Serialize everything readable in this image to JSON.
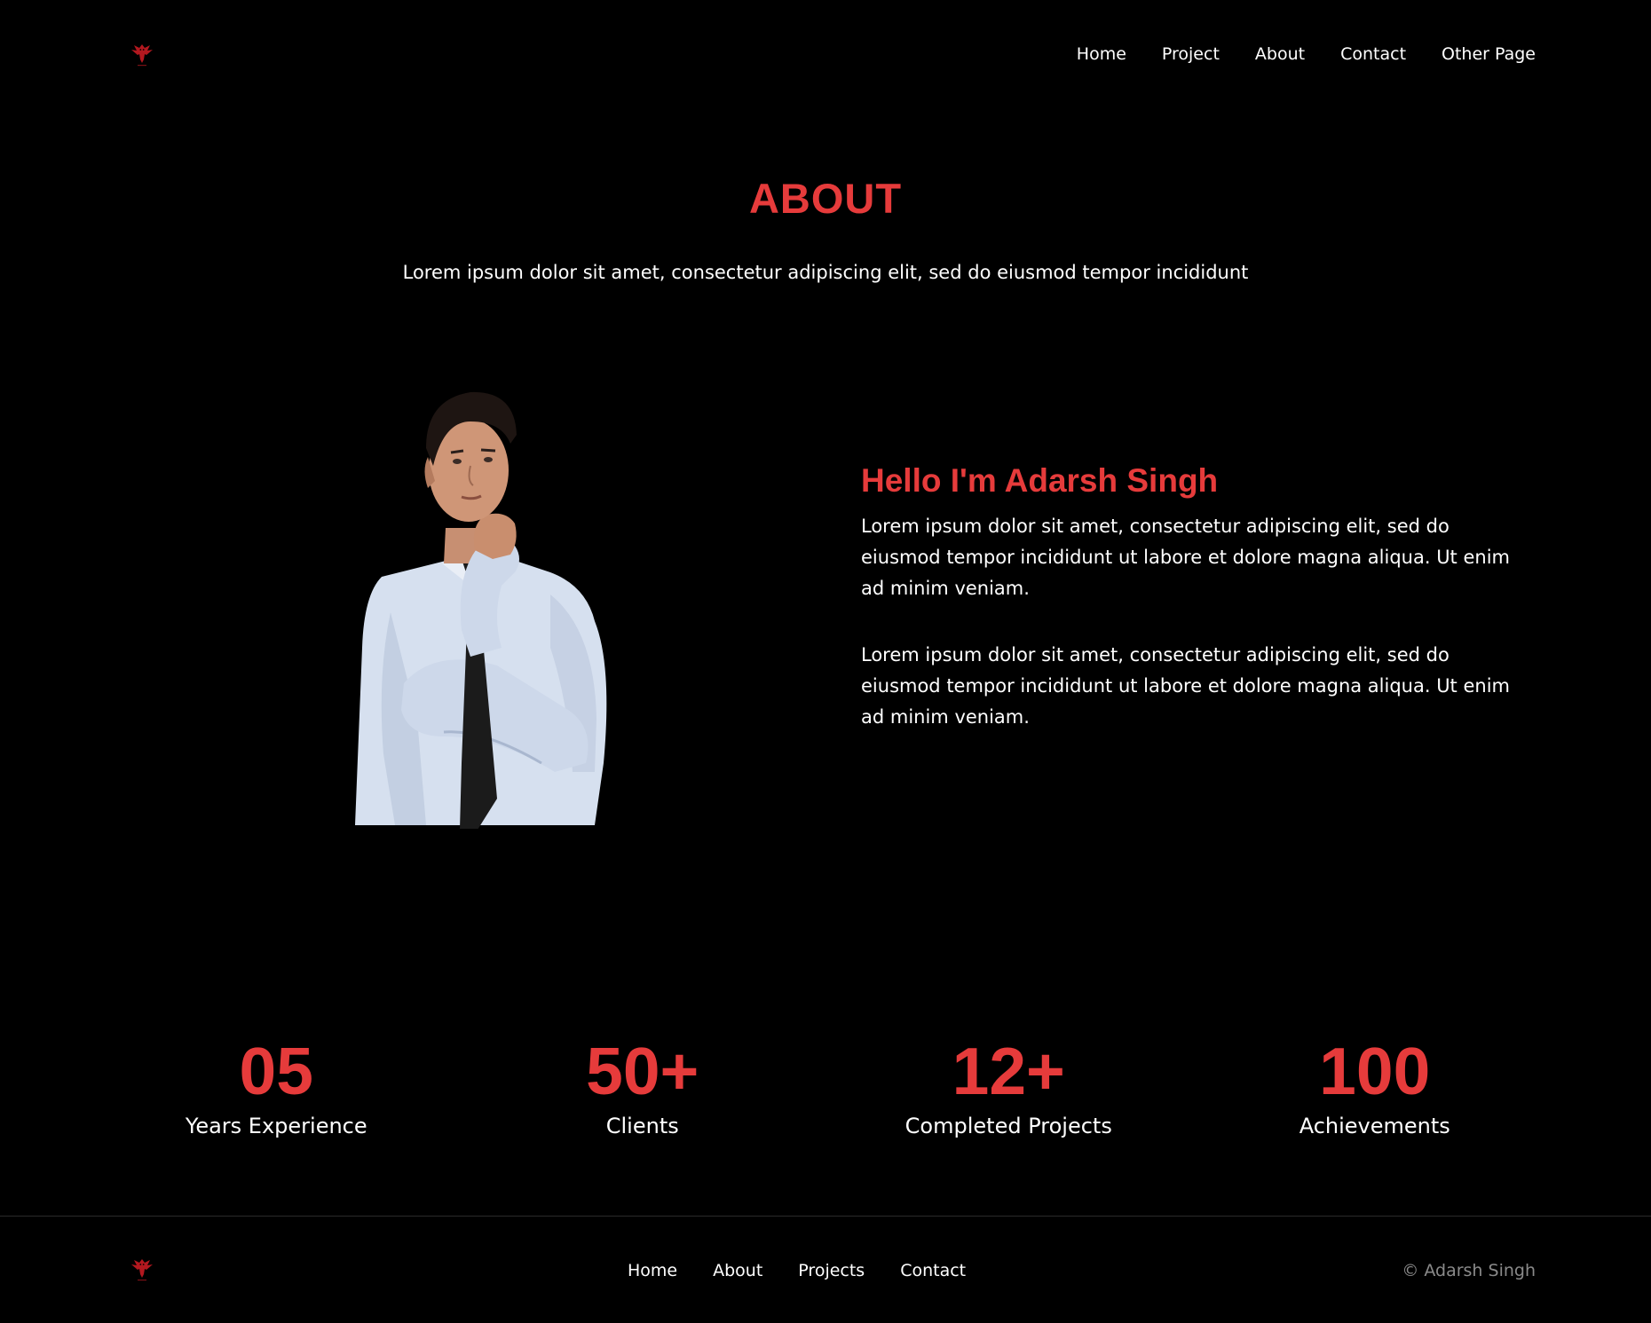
{
  "header": {
    "logo_icon": "red-eagle-logo-icon",
    "nav": [
      "Home",
      "Project",
      "About",
      "Contact",
      "Other Page"
    ]
  },
  "about": {
    "title": "ABOUT",
    "subtitle": "Lorem ipsum dolor sit amet, consectetur adipiscing elit, sed do eiusmod tempor incididunt"
  },
  "bio": {
    "name": "Hello I'm Adarsh Singh",
    "paragraphs": [
      "Lorem ipsum dolor sit amet, consectetur adipiscing elit, sed do eiusmod tempor incididunt ut labore et dolore magna aliqua. Ut enim ad minim veniam.",
      "Lorem ipsum dolor sit amet, consectetur adipiscing elit, sed do eiusmod tempor incididunt ut labore et dolore magna aliqua. Ut enim ad minim veniam."
    ]
  },
  "stats": [
    {
      "value": "05",
      "label": "Years Experience"
    },
    {
      "value": "50+",
      "label": "Clients"
    },
    {
      "value": "12+",
      "label": "Completed Projects"
    },
    {
      "value": "100",
      "label": "Achievements"
    }
  ],
  "footer": {
    "logo_icon": "red-eagle-logo-icon",
    "nav": [
      "Home",
      "About",
      "Projects",
      "Contact"
    ],
    "copyright": "© Adarsh Singh"
  },
  "colors": {
    "background": "#000000",
    "accent": "#e63b3b",
    "text": "#ffffff",
    "muted": "#8a8a8a"
  }
}
